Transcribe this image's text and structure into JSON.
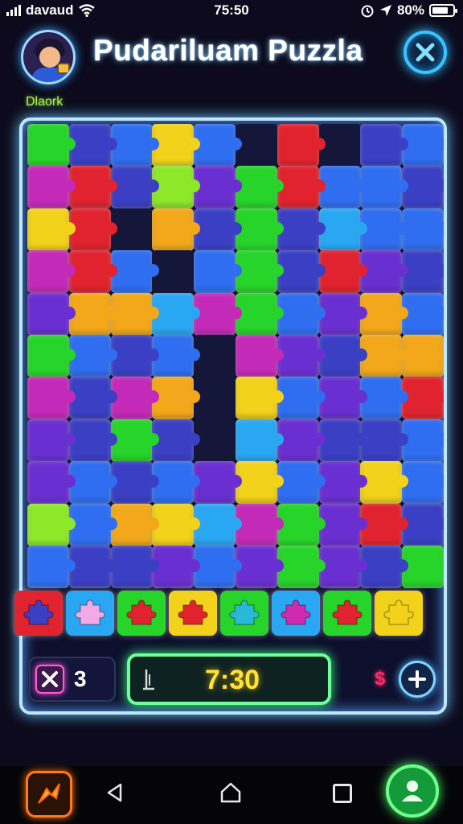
{
  "status_bar": {
    "carrier": "davaud",
    "time": "75:50",
    "battery": "80%"
  },
  "header": {
    "title": "Pudariluam Puzzla",
    "subtitle": "Dlaork"
  },
  "game": {
    "moves_count": "3",
    "timer": "7:30",
    "coin_symbol": "$"
  },
  "colors": {
    "red": "#e0232e",
    "blue": "#2f6ef0",
    "lightblue": "#2aa7f2",
    "navy": "#3a3fc4",
    "purple": "#6a2fd0",
    "magenta": "#c42ab8",
    "green": "#27d42a",
    "lime": "#8ee82a",
    "yellow": "#f2d21a",
    "orange": "#f2a81a"
  },
  "board_rows": [
    [
      "green",
      "navy",
      "blue",
      "yellow",
      "blue",
      "dark",
      "red",
      "dark",
      "navy",
      "blue"
    ],
    [
      "magenta",
      "red",
      "navy",
      "lime",
      "purple",
      "green",
      "red",
      "blue",
      "blue",
      "navy"
    ],
    [
      "yellow",
      "red",
      "dark",
      "orange",
      "navy",
      "green",
      "navy",
      "lightblue",
      "blue",
      "blue"
    ],
    [
      "magenta",
      "red",
      "blue",
      "dark",
      "blue",
      "green",
      "navy",
      "red",
      "purple",
      "navy"
    ],
    [
      "purple",
      "orange",
      "orange",
      "lightblue",
      "magenta",
      "green",
      "blue",
      "purple",
      "orange",
      "blue"
    ],
    [
      "green",
      "blue",
      "navy",
      "blue",
      "dark",
      "magenta",
      "purple",
      "navy",
      "orange",
      "orange"
    ],
    [
      "magenta",
      "navy",
      "magenta",
      "orange",
      "dark",
      "yellow",
      "blue",
      "purple",
      "blue",
      "red"
    ],
    [
      "purple",
      "navy",
      "green",
      "navy",
      "dark",
      "lightblue",
      "purple",
      "navy",
      "navy",
      "blue"
    ],
    [
      "purple",
      "blue",
      "navy",
      "blue",
      "purple",
      "yellow",
      "blue",
      "purple",
      "yellow",
      "blue"
    ],
    [
      "lime",
      "blue",
      "orange",
      "yellow",
      "lightblue",
      "magenta",
      "green",
      "purple",
      "red",
      "navy"
    ],
    [
      "blue",
      "navy",
      "navy",
      "purple",
      "blue",
      "purple",
      "green",
      "purple",
      "navy",
      "green"
    ]
  ],
  "tray": [
    {
      "frame": "red",
      "piece": "navy",
      "icon": "puzzle-piece-icon"
    },
    {
      "frame": "lightblue",
      "piece": "pink",
      "icon": "flower-piece-icon"
    },
    {
      "frame": "green",
      "piece": "red",
      "icon": "puzzle-piece-icon"
    },
    {
      "frame": "yellow",
      "piece": "red",
      "icon": "puzzle-piece-icon"
    },
    {
      "frame": "green",
      "piece": "teal",
      "icon": "puzzle-piece-icon"
    },
    {
      "frame": "lightblue",
      "piece": "magenta",
      "icon": "puzzle-piece-icon"
    },
    {
      "frame": "green",
      "piece": "red",
      "icon": "feather-piece-icon"
    },
    {
      "frame": "yellow",
      "piece": "yellow",
      "icon": "puzzle-piece-icon"
    }
  ]
}
